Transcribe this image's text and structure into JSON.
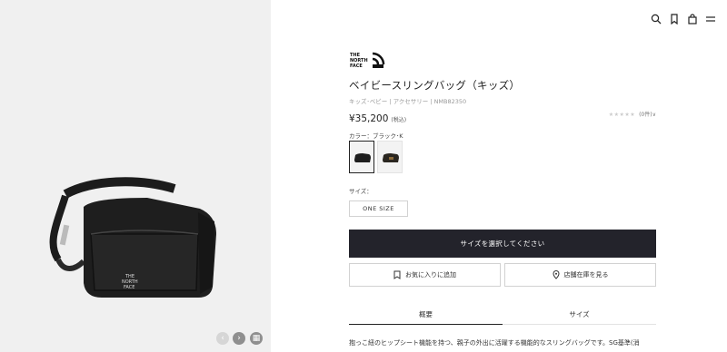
{
  "header": {
    "icons": [
      "search-icon",
      "bookmark-icon",
      "bag-icon",
      "menu-icon"
    ]
  },
  "gallery": {
    "controls": [
      "chevron-left-icon",
      "chevron-right-icon",
      "grid-icon"
    ]
  },
  "product": {
    "brand": "THE NORTH FACE",
    "title": "ベイビースリングバッグ（キッズ）",
    "breadcrumb": "キッズ･ベビー | アクセサリー | NMB82350",
    "price": "¥35,200",
    "tax": "(税込)",
    "rating_count": "(0件)∨",
    "color_label": "カラー：ブラック･K",
    "size_label": "サイズ：",
    "size_option": "ONE SIZE",
    "cta": "サイズを選択してください",
    "favorite": "お気に入りに追加",
    "store": "店舗在庫を見る",
    "tabs": [
      "概要",
      "サイズ"
    ],
    "description": "抱っこ紐のヒップシート機能を持つ、親子の外出に活躍する機能的なスリングバッグです。SG基準(消"
  },
  "colors": {
    "cta_bg": "#23232b",
    "gallery_bg": "#f0f0f0"
  }
}
